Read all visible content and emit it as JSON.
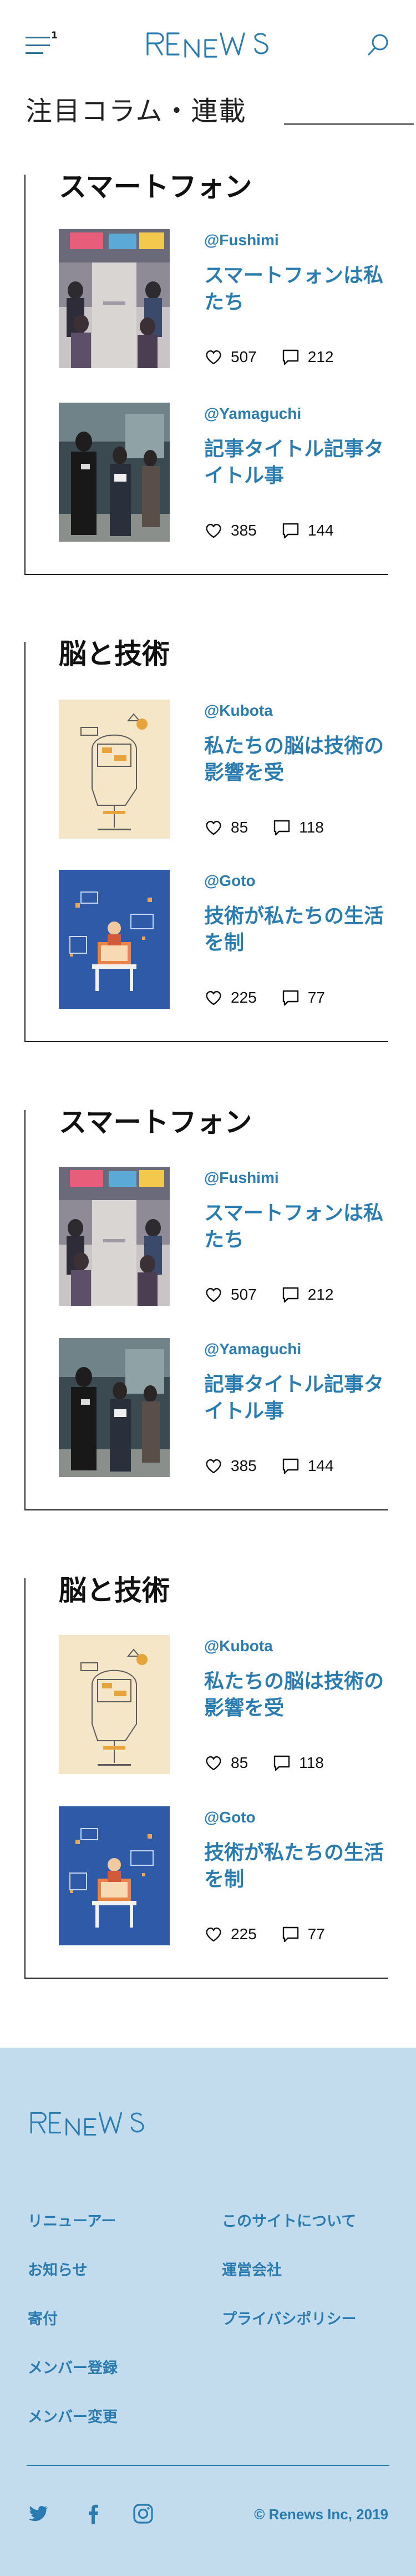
{
  "header": {
    "menu_badge": "1",
    "logo_text": "RENEWS",
    "page_title": "注目コラム・連載"
  },
  "sections": [
    {
      "title": "スマートフォン",
      "articles": [
        {
          "author": "@Fushimi",
          "headline": "スマートフォンは私たち",
          "likes": "507",
          "comments": "212",
          "thumb": "train-photo"
        },
        {
          "author": "@Yamaguchi",
          "headline": "記事タイトル記事タイトル事",
          "likes": "385",
          "comments": "144",
          "thumb": "station-photo"
        }
      ]
    },
    {
      "title": "脳と技術",
      "articles": [
        {
          "author": "@Kubota",
          "headline": "私たちの脳は技術の影響を受",
          "likes": "85",
          "comments": "118",
          "thumb": "head-illustration"
        },
        {
          "author": "@Goto",
          "headline": "技術が私たちの生活を制",
          "likes": "225",
          "comments": "77",
          "thumb": "desk-illustration"
        }
      ]
    },
    {
      "title": "スマートフォン",
      "articles": [
        {
          "author": "@Fushimi",
          "headline": "スマートフォンは私たち",
          "likes": "507",
          "comments": "212",
          "thumb": "train-photo"
        },
        {
          "author": "@Yamaguchi",
          "headline": "記事タイトル記事タイトル事",
          "likes": "385",
          "comments": "144",
          "thumb": "station-photo"
        }
      ]
    },
    {
      "title": "脳と技術",
      "articles": [
        {
          "author": "@Kubota",
          "headline": "私たちの脳は技術の影響を受",
          "likes": "85",
          "comments": "118",
          "thumb": "head-illustration"
        },
        {
          "author": "@Goto",
          "headline": "技術が私たちの生活を制",
          "likes": "225",
          "comments": "77",
          "thumb": "desk-illustration"
        }
      ]
    }
  ],
  "footer": {
    "logo_text": "RENEWS",
    "links_left": [
      "リニューアー",
      "お知らせ",
      "寄付",
      "メンバー登録",
      "メンバー変更"
    ],
    "links_right": [
      "このサイトについて",
      "運営会社",
      "プライバシポリシー"
    ],
    "social": [
      "twitter-icon",
      "facebook-icon",
      "instagram-icon"
    ],
    "copyright": "© Renews Inc, 2019"
  },
  "colors": {
    "accent": "#2a7bb0",
    "footer_bg": "#c3dced",
    "text": "#111111"
  }
}
